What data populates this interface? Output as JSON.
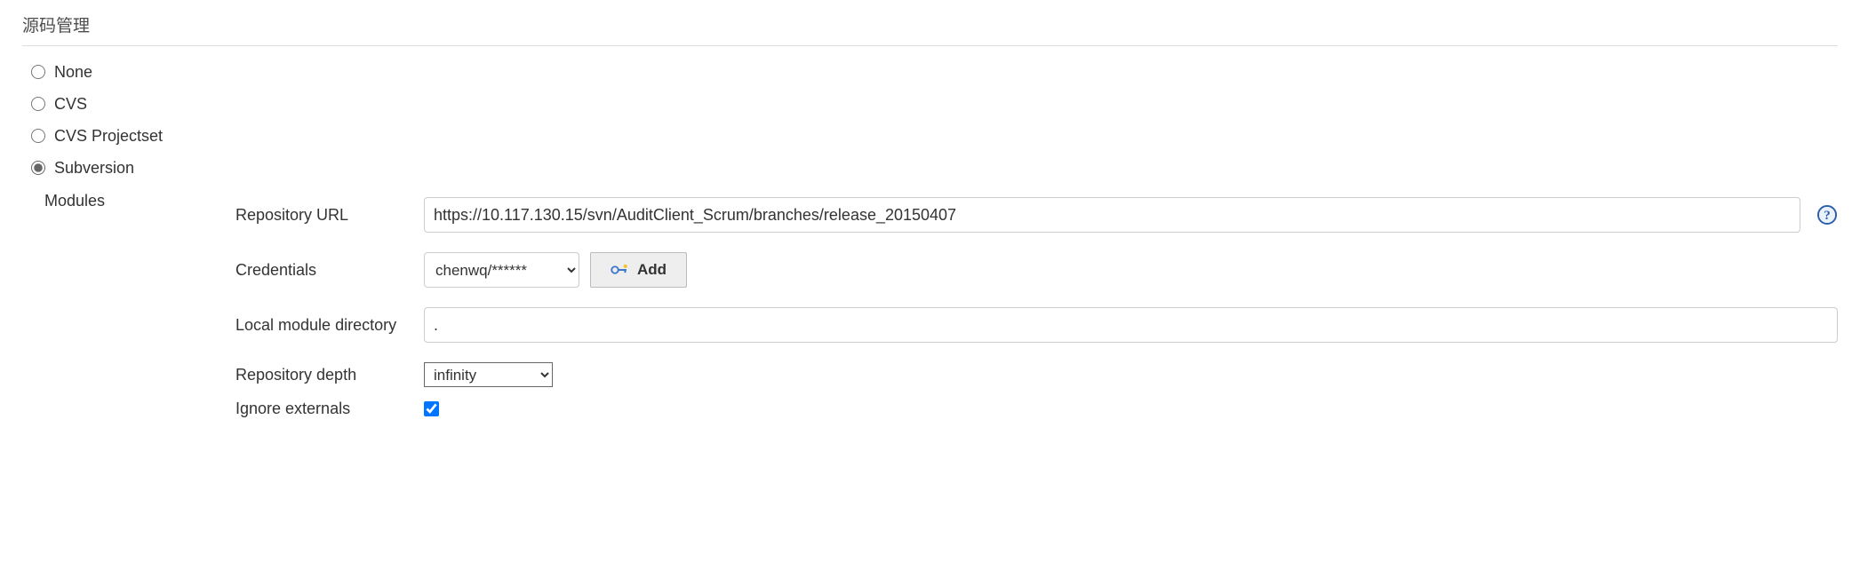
{
  "section": {
    "title": "源码管理"
  },
  "scm": {
    "options": {
      "none": "None",
      "cvs": "CVS",
      "cvs_projectset": "CVS Projectset",
      "subversion": "Subversion"
    },
    "selected": "subversion"
  },
  "modules": {
    "section_label": "Modules",
    "labels": {
      "repo_url": "Repository URL",
      "credentials": "Credentials",
      "local_dir": "Local module directory",
      "repo_depth": "Repository depth",
      "ignore_externals": "Ignore externals",
      "add_btn": "Add"
    },
    "values": {
      "repo_url": "https://10.117.130.15/svn/AuditClient_Scrum/branches/release_20150407",
      "credentials_selected": "chenwq/******",
      "local_dir": ".",
      "repo_depth_selected": "infinity",
      "ignore_externals": true
    },
    "depth_options": [
      "infinity"
    ]
  }
}
